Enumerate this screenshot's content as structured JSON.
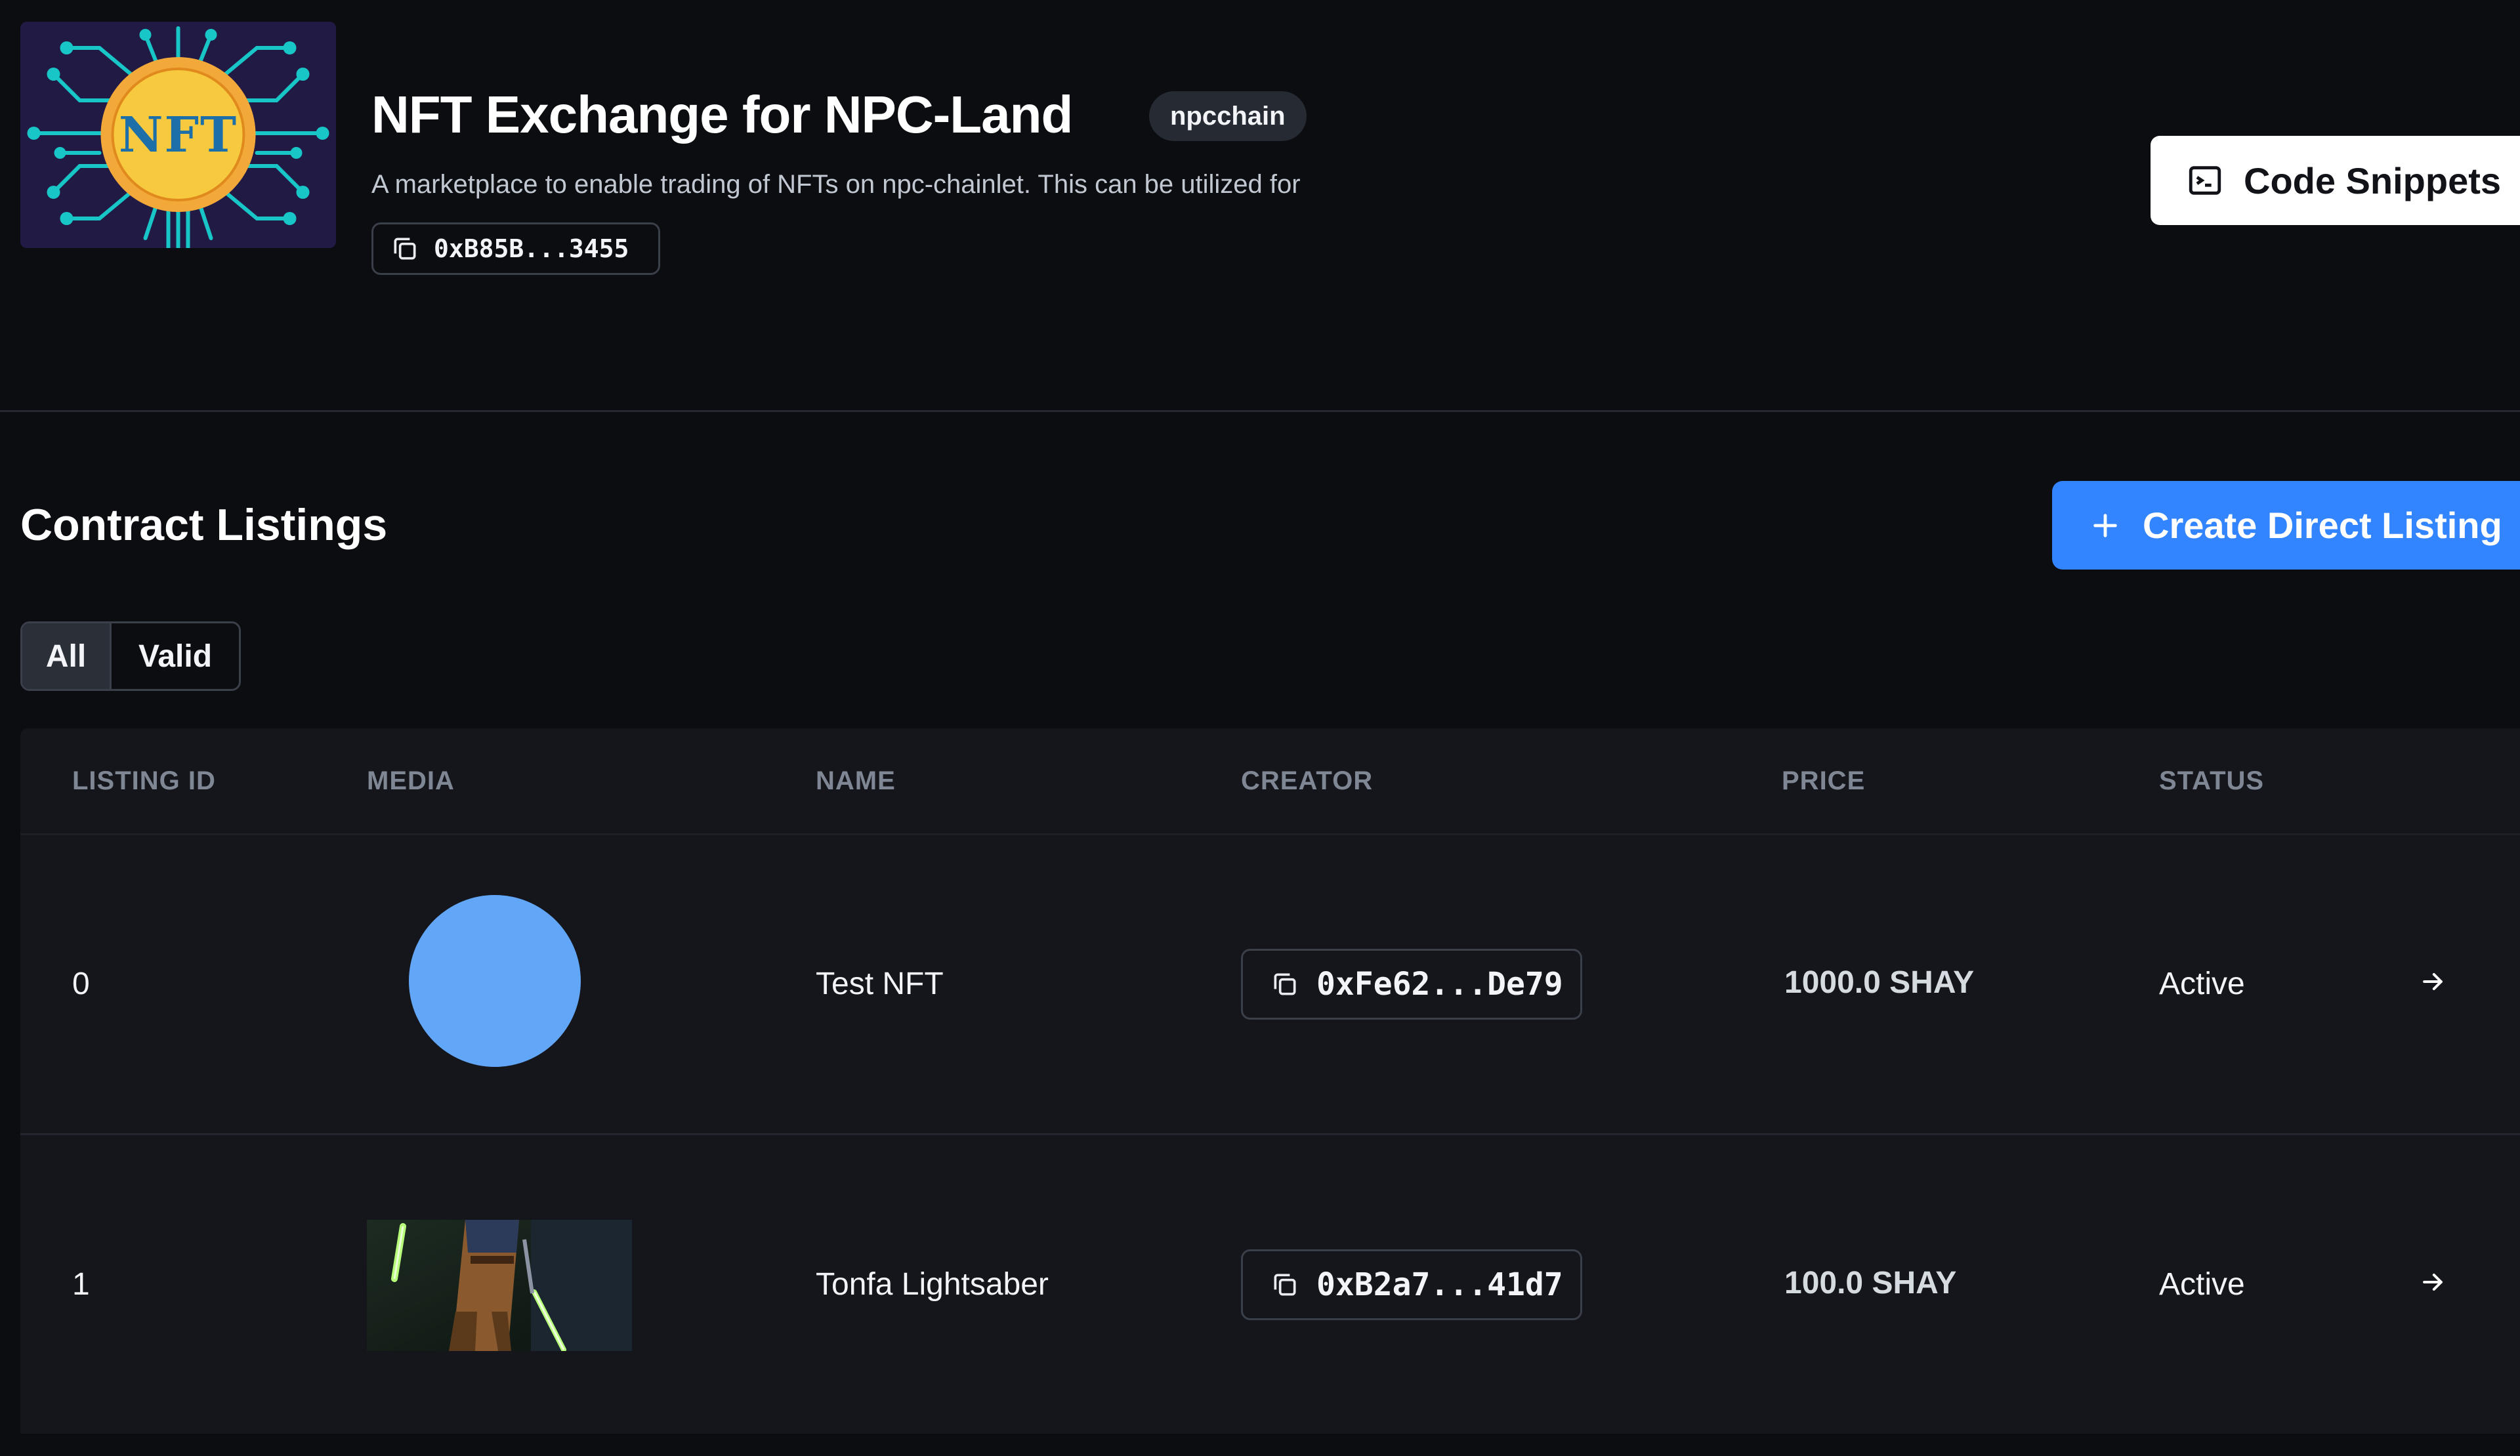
{
  "contract": {
    "logo_text": "NFT",
    "title": "NFT Exchange for NPC-Land",
    "chain": "npcchain",
    "description": "A marketplace to enable trading of NFTs on npc-chainlet. This can be utilized for",
    "address": "0xB85B...3455"
  },
  "actions": {
    "code_snippets": "Code Snippets",
    "create_listing": "Create Direct Listing"
  },
  "listings": {
    "title": "Contract Listings",
    "filters": [
      "All",
      "Valid"
    ],
    "active_filter": "All",
    "columns": [
      "LISTING ID",
      "MEDIA",
      "NAME",
      "CREATOR",
      "PRICE",
      "STATUS"
    ],
    "rows": [
      {
        "id": "0",
        "name": "Test NFT",
        "creator": "0xFe62...De79",
        "price": "1000.0 SHAY",
        "status": "Active"
      },
      {
        "id": "1",
        "name": "Tonfa Lightsaber",
        "creator": "0xB2a7...41d7",
        "price": "100.0 SHAY",
        "status": "Active"
      }
    ]
  },
  "colors": {
    "background": "#0c0d11",
    "table": "#14161b",
    "accent": "#3385ff",
    "circle_media": "#62a6f7",
    "logo_circuit": "#18c6c7",
    "logo_sun": "#f7c93e"
  },
  "icons": [
    "copy-icon",
    "terminal-icon",
    "plus-icon",
    "arrow-right-icon"
  ]
}
